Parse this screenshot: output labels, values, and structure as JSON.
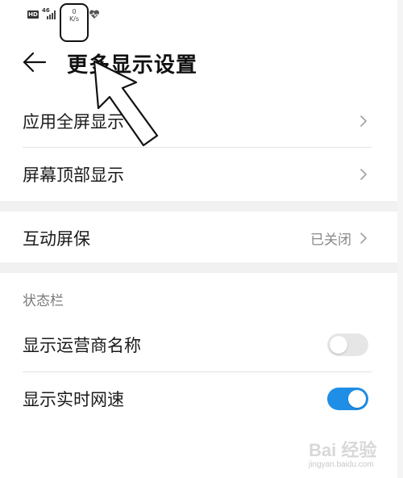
{
  "status_bar": {
    "hd": "HD",
    "network": "46",
    "speed_value": "0",
    "speed_unit": "K/s"
  },
  "header": {
    "title": "更多显示设置"
  },
  "settings": {
    "fullscreen_label": "应用全屏显示",
    "top_display_label": "屏幕顶部显示",
    "screensaver_label": "互动屏保",
    "screensaver_value": "已关闭",
    "section_status_bar": "状态栏",
    "carrier_label": "显示运营商名称",
    "carrier_toggle": "off",
    "net_speed_label": "显示实时网速",
    "net_speed_toggle": "on"
  },
  "watermark": {
    "brand": "Bai 经验",
    "url": "jingyan.baidu.com"
  },
  "colors": {
    "accent": "#1f8ee6",
    "toggle_off": "#e6e6e6",
    "divider": "#e2e2e2",
    "section_band": "#f1f1f1"
  }
}
